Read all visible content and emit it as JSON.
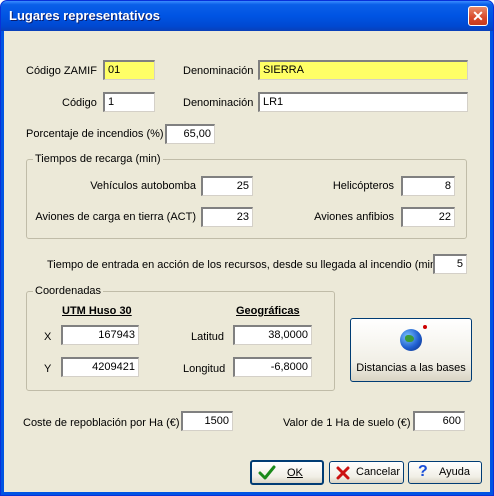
{
  "window": {
    "title": "Lugares representativos",
    "close": "✕"
  },
  "top": {
    "codigo_zamif_label": "Código ZAMIF",
    "codigo_zamif_value": "01",
    "denominacion1_label": "Denominación",
    "denominacion1_value": "SIERRA",
    "codigo_label": "Código",
    "codigo_value": "1",
    "denominacion2_label": "Denominación",
    "denominacion2_value": "LR1",
    "porcentaje_label": "Porcentaje de incendios (%)",
    "porcentaje_value": "65,00"
  },
  "recarga": {
    "legend": "Tiempos de recarga (min)",
    "vehiculos_label": "Vehículos autobomba",
    "vehiculos_value": "25",
    "helicopteros_label": "Helicópteros",
    "helicopteros_value": "8",
    "aviones_label": "Aviones de carga en tierra (ACT)",
    "aviones_value": "23",
    "anfibios_label": "Aviones anfibios",
    "anfibios_value": "22"
  },
  "entrada": {
    "label": "Tiempo de entrada en acción de los recursos, desde su llegada al incendio (min)",
    "value": "5"
  },
  "coordenadas": {
    "legend": "Coordenadas",
    "utm_header": "UTM Huso 30",
    "geo_header": "Geográficas",
    "x_label": "X",
    "x_value": "167943",
    "y_label": "Y",
    "y_value": "4209421",
    "latitud_label": "Latitud",
    "latitud_value": "38,0000",
    "longitud_label": "Longitud",
    "longitud_value": "-6,8000"
  },
  "distancias_button": "Distancias a las bases",
  "coste": {
    "label": "Coste de repoblación por Ha (€)",
    "value": "1500"
  },
  "valor": {
    "label": "Valor de 1 Ha de suelo (€)",
    "value": "600"
  },
  "buttons": {
    "ok": "OK",
    "cancel": "Cancelar",
    "help": "Ayuda"
  }
}
